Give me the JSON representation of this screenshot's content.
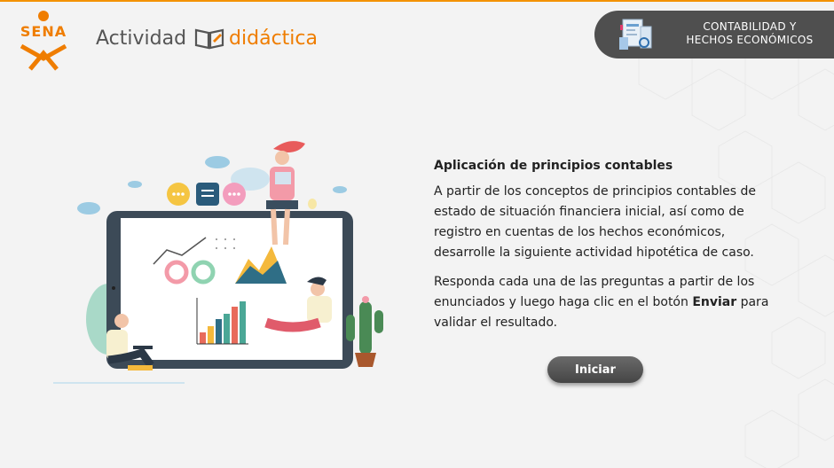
{
  "logo": {
    "text": "SENA"
  },
  "brand": {
    "word1": "Actividad",
    "word2": "didáctica"
  },
  "module": {
    "line1": "CONTABILIDAD Y",
    "line2": "HECHOS ECONÓMICOS"
  },
  "activity": {
    "title": "Aplicación de principios contables",
    "paragraph1": "A partir de los conceptos de principios contables de estado de situación financiera inicial, así como de registro en cuentas de los hechos económicos, desarrolle la siguiente actividad hipotética de caso.",
    "paragraph2_before": "Responda cada una de las preguntas a partir de los enunciados y luego haga clic en el botón ",
    "paragraph2_bold": "Enviar",
    "paragraph2_after": " para validar el resultado."
  },
  "start_button": {
    "label": "Iniciar"
  },
  "colors": {
    "accent": "#ef7d00",
    "pill": "#4f4f4f",
    "button": "#555555"
  }
}
